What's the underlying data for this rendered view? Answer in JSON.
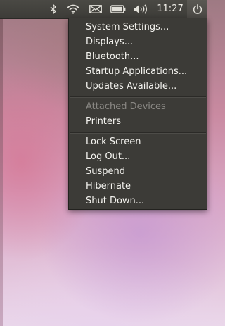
{
  "panel": {
    "clock": "11:27",
    "indicators": [
      "bluetooth-icon",
      "wifi-icon",
      "mail-icon",
      "battery-icon",
      "volume-icon",
      "power-icon"
    ]
  },
  "menu": {
    "items": {
      "system_settings": "System Settings...",
      "displays": "Displays...",
      "bluetooth": "Bluetooth...",
      "startup_applications": "Startup Applications...",
      "updates_available": "Updates Available...",
      "attached_devices": "Attached Devices",
      "printers": "Printers",
      "lock_screen": "Lock Screen",
      "log_out": "Log Out...",
      "suspend": "Suspend",
      "hibernate": "Hibernate",
      "shut_down": "Shut Down..."
    }
  },
  "colors": {
    "panel_bg": "#3d3c38",
    "menu_bg": "#3c3b37",
    "menu_text": "#f4f3ef",
    "disabled_text": "#8a8884"
  }
}
